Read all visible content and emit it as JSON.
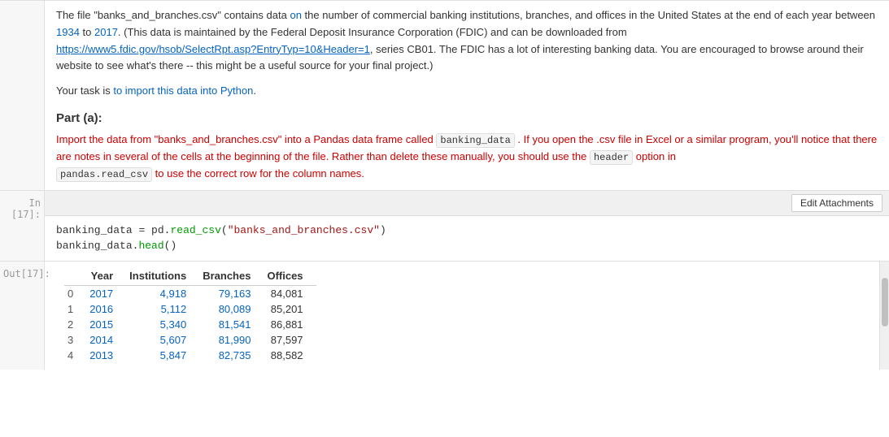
{
  "description": {
    "paragraph1": "The file \"banks_and_branches.csv\" contains data on the number of commercial banking institutions, branches, and offices in the United States at the end of each year between 1934 to 2017. (This data is maintained by the Federal Deposit Insurance Corporation (FDIC) and can be downloaded from",
    "link_text": "https://www5.fdic.gov/hsob/SelectRpt.asp?EntryTyp=10&Header=1",
    "paragraph1_cont": ", series CB01. The FDIC has a lot of interesting banking data. You are encouraged to browse around their website to see what's there -- this might be a useful source for your final project.)",
    "paragraph2": "Your task is to import this data into Python.",
    "part_a_heading": "Part (a):",
    "part_a_text1": "Import the data from \"banks_and_branches.csv\" into a Pandas data frame called",
    "part_a_code1": "banking_data",
    "part_a_text2": ". If you open the .csv file in Excel or a similar program, you'll notice that there are notes in several of the cells at the beginning of the file. Rather than delete these manually, you should use the",
    "part_a_code2": "header",
    "part_a_text3": "option in",
    "part_a_code3": "pandas.read_csv",
    "part_a_text4": "to use the correct row for the column names."
  },
  "cell_in17": {
    "label": "In [17]:",
    "toolbar": {
      "edit_attachments": "Edit Attachments"
    },
    "code_lines": [
      "banking_data = pd.read_csv(\"banks_and_branches.csv\")",
      "banking_data.head()"
    ]
  },
  "cell_out17": {
    "label": "Out[17]:",
    "table": {
      "headers": [
        "",
        "Year",
        "Institutions",
        "Branches",
        "Offices"
      ],
      "rows": [
        {
          "index": "0",
          "year": "2017",
          "institutions": "4,918",
          "branches": "79,163",
          "offices": "84,081"
        },
        {
          "index": "1",
          "year": "2016",
          "institutions": "5,112",
          "branches": "80,089",
          "offices": "85,201"
        },
        {
          "index": "2",
          "year": "2015",
          "institutions": "5,340",
          "branches": "81,541",
          "offices": "86,881"
        },
        {
          "index": "3",
          "year": "2014",
          "institutions": "5,607",
          "branches": "81,990",
          "offices": "87,597"
        },
        {
          "index": "4",
          "year": "2013",
          "institutions": "5,847",
          "branches": "82,735",
          "offices": "88,582"
        }
      ]
    }
  }
}
